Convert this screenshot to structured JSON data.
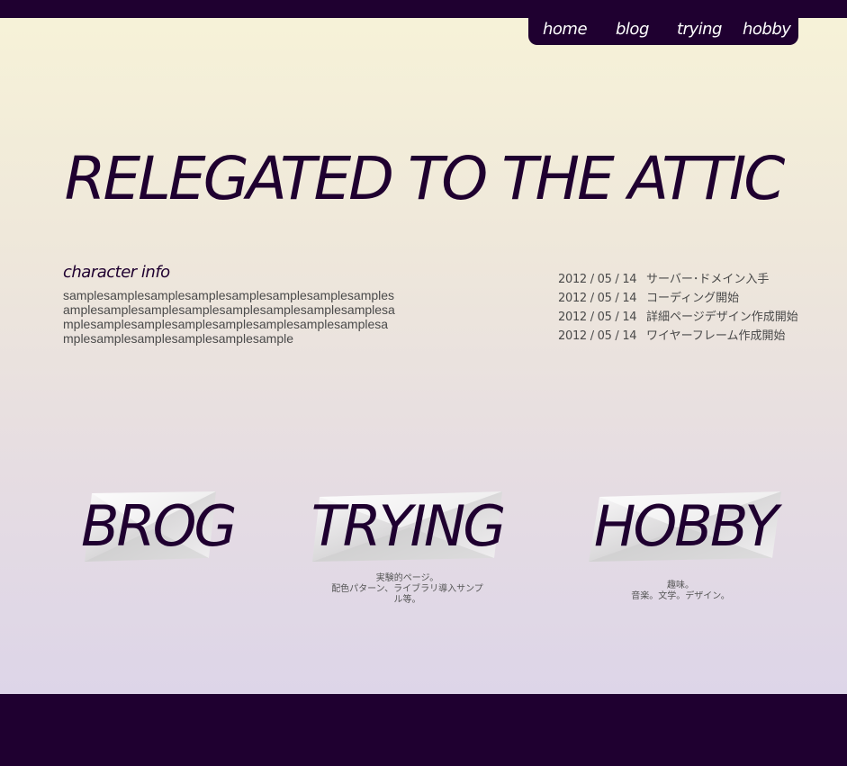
{
  "nav": {
    "items": [
      {
        "label": "home"
      },
      {
        "label": "blog"
      },
      {
        "label": "trying"
      },
      {
        "label": "hobby"
      }
    ]
  },
  "hero": {
    "title": "RELEGATED TO THE ATTIC"
  },
  "character": {
    "heading": "character info",
    "text": "samplesamplesamplesamplesamplesamplesamplesamplesamplesamplesamplesamplesamplesamplesamplesamplesamplesamplesamplesamplesamplesamplesamplesamplesamplesamplesamplesamplesamplesample"
  },
  "news": [
    {
      "date": "2012 / 05 / 14",
      "text": "サーバー･ドメイン入手"
    },
    {
      "date": "2012 / 05 / 14",
      "text": "コーディング開始"
    },
    {
      "date": "2012 / 05 / 14",
      "text": "詳細ページデザイン作成開始"
    },
    {
      "date": "2012 / 05 / 14",
      "text": "ワイヤーフレーム作成開始"
    }
  ],
  "cards": {
    "brog": {
      "label": "BROG"
    },
    "trying": {
      "label": "TRYING",
      "desc_lines": [
        "実験的ページ。",
        "配色パターン、ライブラリ導入サンプ",
        "ル等。"
      ]
    },
    "hobby": {
      "label": "HOBBY",
      "desc_lines": [
        "趣味。",
        "音楽。文学。デザイン。"
      ]
    }
  },
  "colors": {
    "dark": "#1f0030",
    "text_gray": "#4a4a4a"
  }
}
